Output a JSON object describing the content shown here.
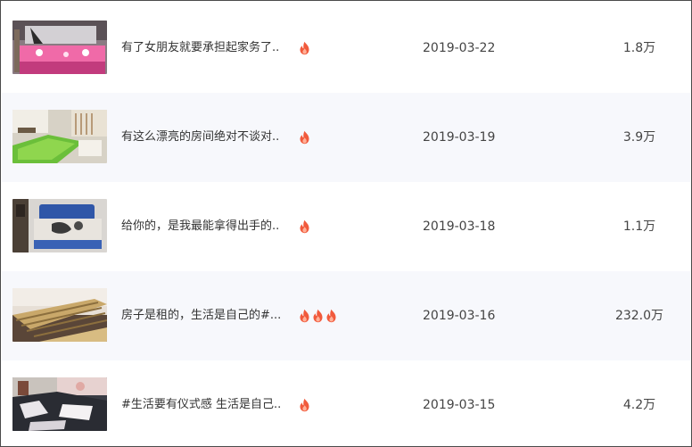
{
  "videos": [
    {
      "title": "有了女朋友就要承担起家务了..",
      "fires": 1,
      "date": "2019-03-22",
      "count": "1.8万",
      "thumb_icon": "pink-bedroom-thumbnail"
    },
    {
      "title": "有这么漂亮的房间绝对不谈对..",
      "fires": 1,
      "date": "2019-03-19",
      "count": "3.9万",
      "thumb_icon": "green-rug-room-thumbnail"
    },
    {
      "title": "给你的，是我最能拿得出手的..",
      "fires": 1,
      "date": "2019-03-18",
      "count": "1.1万",
      "thumb_icon": "blue-bed-thumbnail"
    },
    {
      "title": "房子是租的，生活是自己的#...",
      "fires": 3,
      "date": "2019-03-16",
      "count": "232.0万",
      "thumb_icon": "wooden-bed-slats-thumbnail"
    },
    {
      "title": "#生活要有仪式感 生活是自己..",
      "fires": 1,
      "date": "2019-03-15",
      "count": "4.2万",
      "thumb_icon": "dark-bedding-thumbnail"
    }
  ],
  "colors": {
    "fire": "#f15a3c",
    "fire_inner": "#ffb199",
    "alt_row": "#f7f8fc",
    "border": "#4a4a4a"
  },
  "icons": {
    "hot": "fire-icon"
  }
}
